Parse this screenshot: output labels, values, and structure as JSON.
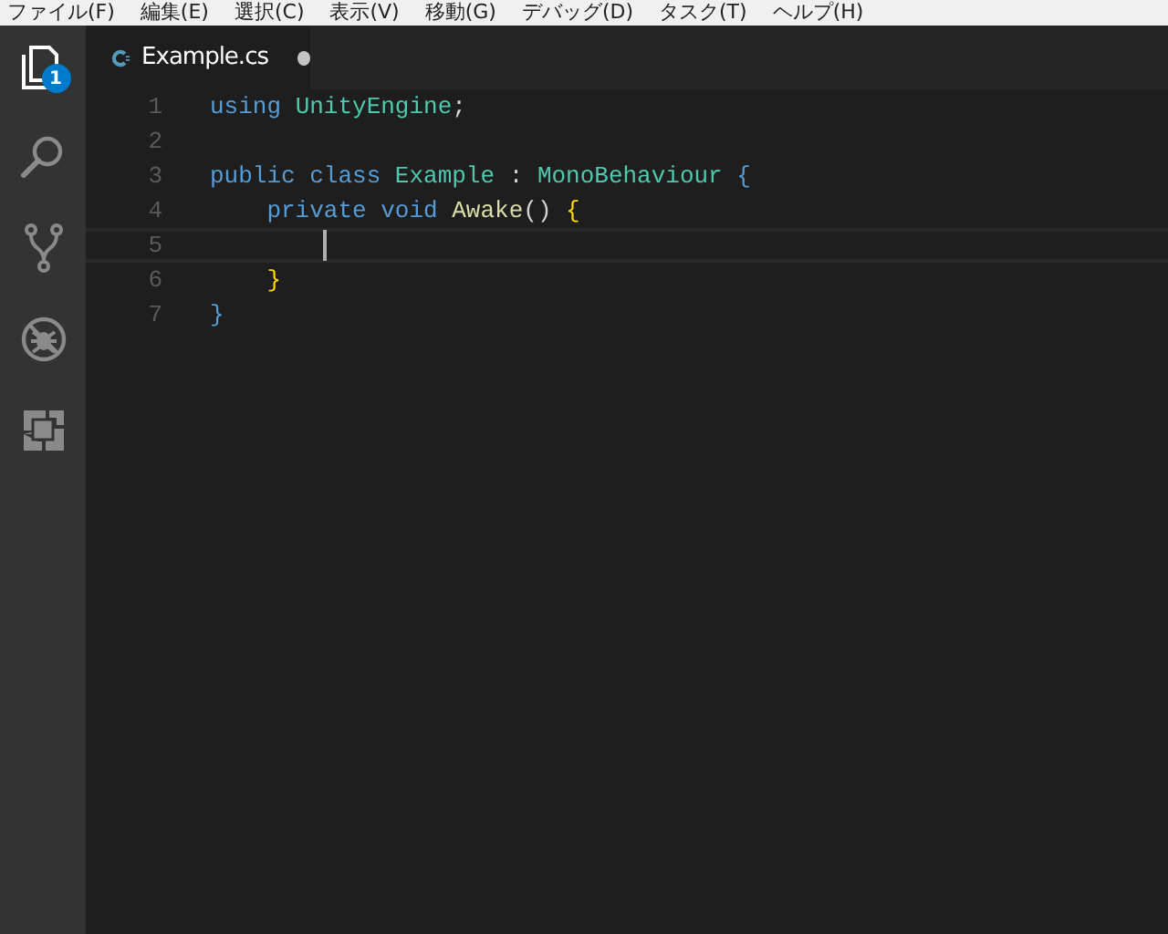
{
  "menu_bar": [
    "ファイル(F)",
    "編集(E)",
    "選択(C)",
    "表示(V)",
    "移動(G)",
    "デバッグ(D)",
    "タスク(T)",
    "ヘルプ(H)"
  ],
  "activity_bar": [
    {
      "kind": "files",
      "selected": true,
      "badge": "1"
    },
    {
      "kind": "search",
      "selected": false
    },
    {
      "kind": "source-control",
      "selected": false
    },
    {
      "kind": "debug",
      "selected": false
    },
    {
      "kind": "extensions",
      "selected": false
    }
  ],
  "tabs": [
    {
      "label": "Example.cs",
      "selected": true,
      "modified": true
    }
  ],
  "editor": {
    "lines": [
      {
        "number": "1",
        "current": false,
        "tokens": [
          {
            "kind": "keyword",
            "text": "using "
          },
          {
            "kind": "type",
            "text": "UnityEngine"
          },
          {
            "kind": "plain",
            "text": ";"
          }
        ]
      },
      {
        "number": "2",
        "current": false
      },
      {
        "number": "3",
        "current": false,
        "tokens": [
          {
            "kind": "keyword",
            "text": "public class "
          },
          {
            "kind": "type",
            "text": "Example"
          },
          {
            "kind": "plain",
            "text": " : "
          },
          {
            "kind": "type",
            "text": "MonoBehaviour"
          },
          {
            "kind": "brace-outer",
            "text": " {"
          }
        ]
      },
      {
        "number": "4",
        "current": false,
        "tokens": [
          {
            "kind": "keyword",
            "text": "    private void "
          },
          {
            "kind": "function",
            "text": "Awake"
          },
          {
            "kind": "plain",
            "text": "() "
          },
          {
            "kind": "brace-inner",
            "text": "{"
          }
        ]
      },
      {
        "number": "5",
        "current": true
      },
      {
        "number": "6",
        "current": false,
        "tokens": [
          {
            "kind": "brace-inner",
            "text": "    }"
          }
        ]
      },
      {
        "number": "7",
        "current": false,
        "tokens": [
          {
            "kind": "brace-outer",
            "text": "}"
          }
        ]
      }
    ]
  }
}
